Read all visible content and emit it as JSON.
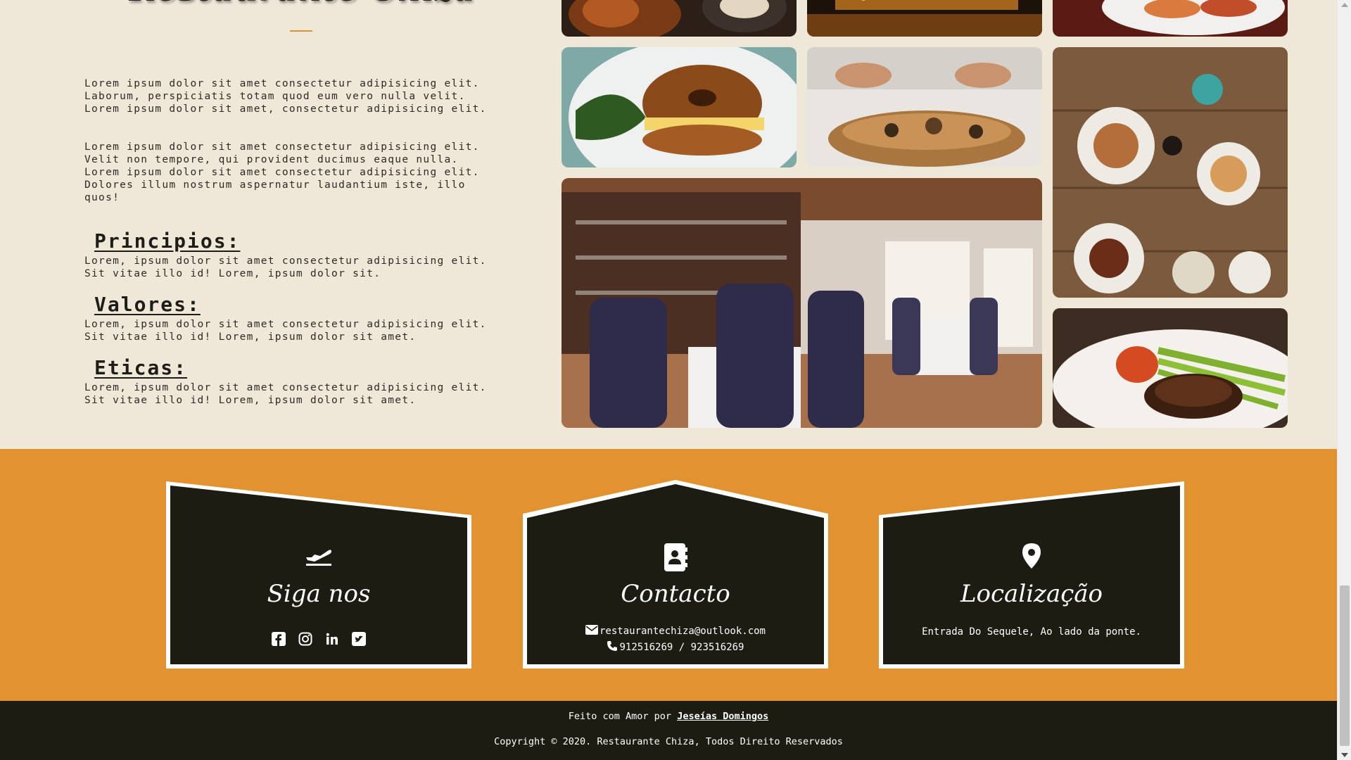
{
  "about": {
    "title": "Restaurante Chiza",
    "paragraph1": "Lorem ipsum dolor sit amet consectetur adipisicing elit.\nLaborum, perspiciatis totam quod eum vero nulla velit.\nLorem ipsum dolor sit amet, consectetur adipisicing elit.",
    "paragraph2": "Lorem ipsum dolor sit amet consectetur adipisicing elit.\nVelit non tempore, qui provident ducimus eaque nulla.\nLorem ipsum dolor sit amet consectetur adipisicing elit.\nDolores illum nostrum aspernatur laudantium iste, illo\nquos!",
    "sections": [
      {
        "heading": "Principios:",
        "text": "Lorem, ipsum dolor sit amet consectetur adipisicing elit.\nSit vitae illo id! Lorem, ipsum dolor sit."
      },
      {
        "heading": "Valores:",
        "text": "Lorem, ipsum dolor sit amet consectetur adipisicing elit.\nSit vitae illo id! Lorem, ipsum dolor sit amet."
      },
      {
        "heading": "Eticas:",
        "text": "Lorem, ipsum dolor sit amet consectetur adipisicing elit.\nSit vitae illo id! Lorem, ipsum dolor sit amet."
      }
    ]
  },
  "gallery": {
    "images": [
      "fried-food-plate",
      "bar-interior",
      "bruschetta-plate",
      "bagel-sandwich",
      "chef-plating",
      "table-of-dishes",
      "dining-room",
      "steak-asparagus"
    ]
  },
  "cards": {
    "follow": {
      "icon": "plane-departure-icon",
      "title": "Siga nos",
      "socials": [
        "facebook-icon",
        "instagram-icon",
        "linkedin-icon",
        "twitter-icon"
      ]
    },
    "contact": {
      "icon": "address-book-icon",
      "title": "Contacto",
      "email": "restaurantechiza@outlook.com",
      "phone": "912516269 / 923516269"
    },
    "location": {
      "icon": "map-marker-icon",
      "title": "Localização",
      "address": "Entrada Do Sequele, Ao lado da ponte."
    }
  },
  "footer": {
    "made_prefix": "Feito com Amor por ",
    "author": "Jeseías Domingos",
    "copyright": "Copyright © 2020. Restaurante Chiza, Todos Direito Reservados"
  },
  "colors": {
    "accent": "#e2922e",
    "dark": "#1c1c12",
    "cream": "#efe7d8"
  }
}
